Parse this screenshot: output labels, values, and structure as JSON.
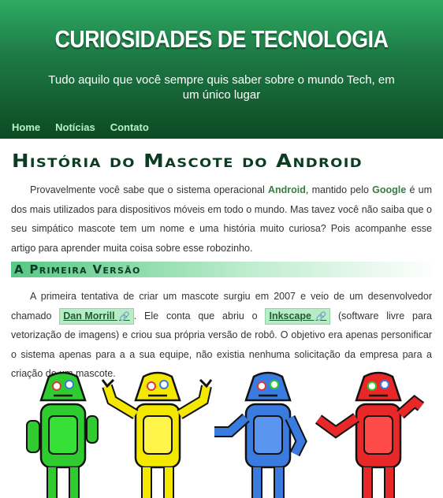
{
  "header": {
    "title": "CURIOSIDADES DE TECNOLOGIA",
    "subtitle": "Tudo aquilo que você sempre quis saber sobre o mundo Tech, em um único lugar"
  },
  "nav": {
    "items": [
      {
        "label": "Home"
      },
      {
        "label": "Notícias"
      },
      {
        "label": "Contato"
      }
    ]
  },
  "article": {
    "title": "História do Mascote do Android",
    "p1": {
      "t1": "Provavelmente você sabe que o sistema operacional ",
      "android": "Android",
      "t2": ", mantido pelo ",
      "google": "Google",
      "t3": " é um dos mais utilizados para dispositivos móveis em todo o mundo. Mas tavez você não saiba que o seu simpático mascote tem um nome e uma história muito curiosa? Pois acompanhe esse artigo para aprender muita coisa sobre esse robozinho."
    },
    "section1": {
      "heading": "A Primeira Versão",
      "t1": "A primeira tentativa de criar um mascote surgiu em 2007 e veio de um desenvolvedor chamado ",
      "link1": "Dan Morrill",
      "t2": ". Ele conta que abriu o ",
      "link2": "Inkscape",
      "t3": " (software livre para vetorização de imagens) e criou sua própria versão de robô. O objetivo era apenas personificar o sistema apenas para a a sua equipe, não existia nenhuma solicitação da empresa para a criação de um mascote."
    },
    "link_icon": "🔗"
  },
  "robots": {
    "colors": [
      "#2ecc2e",
      "#f4e800",
      "#3a7be0",
      "#e82828"
    ]
  }
}
